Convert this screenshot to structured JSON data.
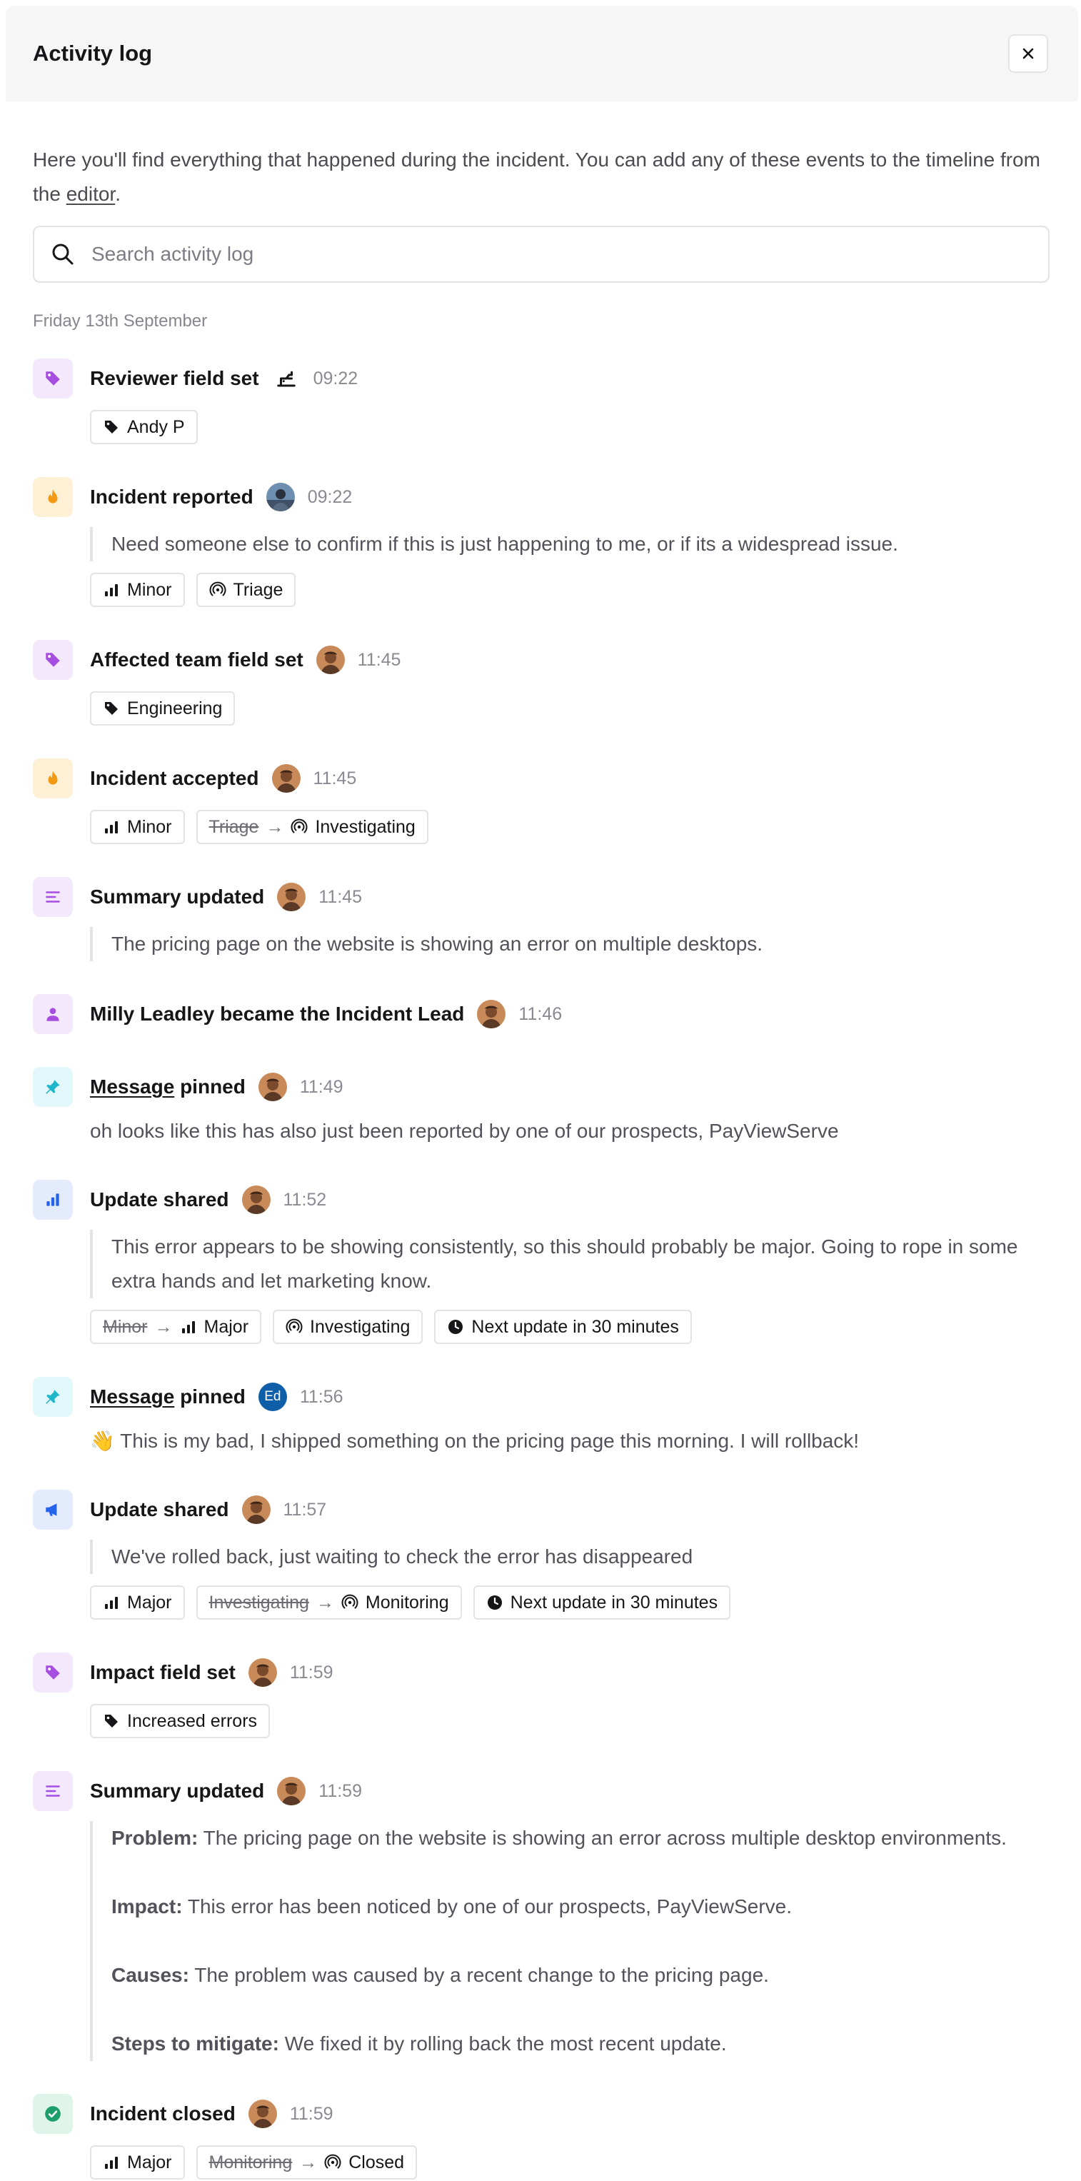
{
  "header": {
    "title": "Activity log"
  },
  "intro": {
    "text_before": "Here you'll find everything that happened during the incident. You can add any of these events to the timeline from the ",
    "link": "editor",
    "text_after": "."
  },
  "search": {
    "placeholder": "Search activity log"
  },
  "date": "Friday 13th September",
  "colors": {
    "purple_bg": "#f4e8fc",
    "purple": "#a64ee0",
    "yellow_bg": "#fdf0d5",
    "yellow": "#f29a14",
    "red_bg": "#fde6e3",
    "red": "#ef4e38",
    "teal_bg": "#e2f8fb",
    "teal": "#1fb6c9",
    "blue_bg": "#e3ebfd",
    "blue": "#2563eb",
    "green_bg": "#dff5ea",
    "green": "#1e9e6a"
  },
  "events": [
    {
      "title": "Reviewer field set",
      "time": "09:22",
      "icon": "tag-icon",
      "avatar": "robot-icon",
      "chips": [
        {
          "icon": "tag-icon",
          "label": "Andy P"
        }
      ]
    },
    {
      "title": "Incident reported",
      "time": "09:22",
      "icon": "flame-icon",
      "avatar": "photo-avatar-blue",
      "quote": "Need someone else to confirm if this is just happening to me, or if its a widespread issue.",
      "chips": [
        {
          "icon": "severity-icon",
          "label": "Minor"
        },
        {
          "icon": "status-icon",
          "label": "Triage"
        }
      ]
    },
    {
      "title": "Affected team field set",
      "time": "11:45",
      "icon": "tag-icon",
      "avatar": "photo-avatar",
      "chips": [
        {
          "icon": "tag-icon",
          "label": "Engineering"
        }
      ]
    },
    {
      "title": "Incident accepted",
      "time": "11:45",
      "icon": "flame-icon",
      "avatar": "photo-avatar",
      "chips": [
        {
          "icon": "severity-icon",
          "label": "Minor"
        },
        {
          "from": "Triage",
          "icon": "status-icon",
          "label": "Investigating"
        }
      ]
    },
    {
      "title": "Summary updated",
      "time": "11:45",
      "icon": "text-lines-icon",
      "avatar": "photo-avatar",
      "quote": "The pricing page on the website is showing an error on multiple desktops."
    },
    {
      "title": "Milly Leadley became the Incident Lead",
      "time": "11:46",
      "icon": "person-icon",
      "avatar": "photo-avatar"
    },
    {
      "title_link": "Message",
      "title": " pinned",
      "time": "11:49",
      "icon": "pin-icon",
      "avatar": "photo-avatar",
      "plain": "oh looks like this has also just been reported by one of our prospects, PayViewServe"
    },
    {
      "title": "Update shared",
      "time": "11:52",
      "icon": "bar-chart-icon",
      "avatar": "photo-avatar",
      "quote": "This error appears to be showing consistently, so this should probably be major. Going to rope in some extra hands and let marketing know.",
      "chips": [
        {
          "from": "Minor",
          "icon": "severity-icon",
          "label": "Major"
        },
        {
          "icon": "status-icon",
          "label": "Investigating"
        },
        {
          "icon": "clock-icon",
          "label": "Next update in 30 minutes"
        }
      ]
    },
    {
      "title_link": "Message",
      "title": " pinned",
      "time": "11:56",
      "icon": "pin-icon",
      "avatar": "initials-avatar",
      "avatar_initials": "Ed",
      "plain": "👋 This is my bad, I shipped something on the pricing page this morning. I will rollback!"
    },
    {
      "title": "Update shared",
      "time": "11:57",
      "icon": "megaphone-icon",
      "avatar": "photo-avatar",
      "quote": "We've rolled back, just waiting to check the error has disappeared",
      "chips": [
        {
          "icon": "severity-icon",
          "label": "Major"
        },
        {
          "from": "Investigating",
          "icon": "status-icon",
          "label": "Monitoring"
        },
        {
          "icon": "clock-icon",
          "label": "Next update in 30 minutes"
        }
      ]
    },
    {
      "title": "Impact field set",
      "time": "11:59",
      "icon": "tag-icon",
      "avatar": "photo-avatar",
      "chips": [
        {
          "icon": "tag-icon",
          "label": "Increased errors"
        }
      ]
    },
    {
      "title": "Summary updated",
      "time": "11:59",
      "icon": "text-lines-icon",
      "avatar": "photo-avatar",
      "summary": [
        {
          "label": "Problem:",
          "text": " The pricing page on the website is showing an error across multiple desktop environments."
        },
        {
          "label": "Impact:",
          "text": " This error has been noticed by one of our prospects, PayViewServe."
        },
        {
          "label": "Causes:",
          "text": " The problem was caused by a recent change to the pricing page."
        },
        {
          "label": "Steps to mitigate:",
          "text": " We fixed it by rolling back the most recent update."
        }
      ]
    },
    {
      "title": "Incident closed",
      "time": "11:59",
      "icon": "check-circle-icon",
      "avatar": "photo-avatar",
      "chips": [
        {
          "icon": "severity-icon",
          "label": "Major"
        },
        {
          "from": "Monitoring",
          "icon": "status-icon",
          "label": "Closed"
        }
      ]
    }
  ]
}
